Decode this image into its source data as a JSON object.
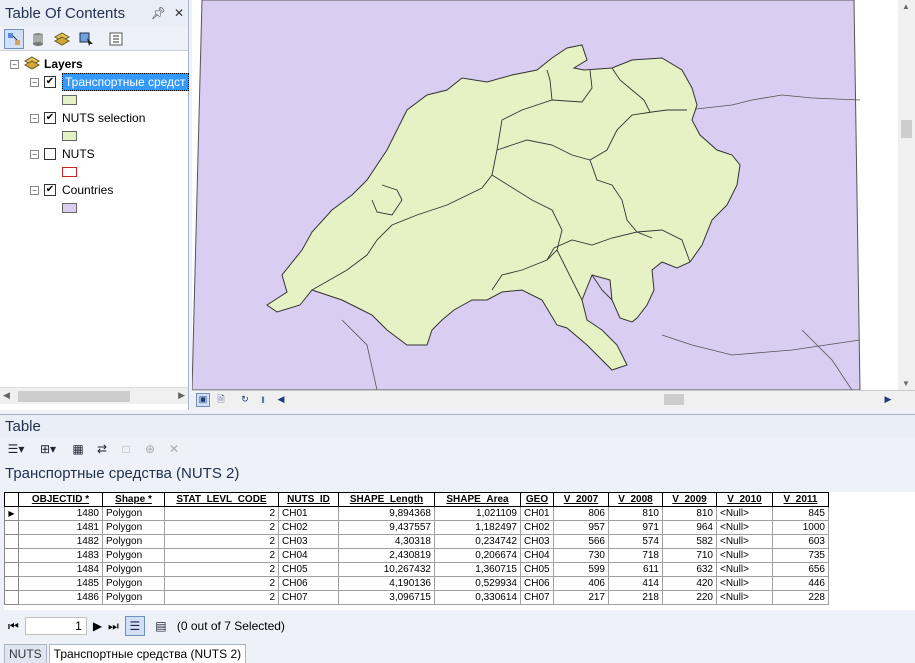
{
  "toc": {
    "title": "Table Of Contents",
    "pin_icon": "pin-icon",
    "close_icon": "close-icon",
    "root_label": "Layers",
    "layers": [
      {
        "label": "Транспортные средст",
        "checked": true,
        "selected": true,
        "fill": "#e6f2c4",
        "stroke": "#444444"
      },
      {
        "label": "NUTS selection",
        "checked": true,
        "selected": false,
        "fill": "#e6f2c4",
        "stroke": "#444444"
      },
      {
        "label": "NUTS",
        "checked": false,
        "selected": false,
        "fill": "#ffffff",
        "stroke": "#cc2222"
      },
      {
        "label": "Countries",
        "checked": true,
        "selected": false,
        "fill": "#d9cdf2",
        "stroke": "#444444"
      }
    ]
  },
  "map": {
    "background": "#d9cdf2",
    "region_fill": "#e6f2c4",
    "border_color": "#333333"
  },
  "table": {
    "window_title": "Table",
    "layer_title": "Транспортные средства (NUTS 2)",
    "columns": [
      "OBJECTID *",
      "Shape *",
      "STAT_LEVL_CODE",
      "NUTS_ID",
      "SHAPE_Length",
      "SHAPE_Area",
      "GEO",
      "V_2007",
      "V_2008",
      "V_2009",
      "V_2010",
      "V_2011"
    ],
    "rows": [
      [
        "1480",
        "Polygon",
        "2",
        "CH01",
        "9,894368",
        "1,021109",
        "CH01",
        "806",
        "810",
        "810",
        "<Null>",
        "845"
      ],
      [
        "1481",
        "Polygon",
        "2",
        "CH02",
        "9,437557",
        "1,182497",
        "CH02",
        "957",
        "971",
        "964",
        "<Null>",
        "1000"
      ],
      [
        "1482",
        "Polygon",
        "2",
        "CH03",
        "4,30318",
        "0,234742",
        "CH03",
        "566",
        "574",
        "582",
        "<Null>",
        "603"
      ],
      [
        "1483",
        "Polygon",
        "2",
        "CH04",
        "2,430819",
        "0,206674",
        "CH04",
        "730",
        "718",
        "710",
        "<Null>",
        "735"
      ],
      [
        "1484",
        "Polygon",
        "2",
        "CH05",
        "10,267432",
        "1,360715",
        "CH05",
        "599",
        "611",
        "632",
        "<Null>",
        "656"
      ],
      [
        "1485",
        "Polygon",
        "2",
        "CH06",
        "4,190136",
        "0,529934",
        "CH06",
        "406",
        "414",
        "420",
        "<Null>",
        "446"
      ],
      [
        "1486",
        "Polygon",
        "2",
        "CH07",
        "3,096715",
        "0,330614",
        "CH07",
        "217",
        "218",
        "220",
        "<Null>",
        "228"
      ]
    ],
    "record_number": "1",
    "selection_status": "(0 out of 7 Selected)",
    "tabs": [
      "NUTS",
      "Транспортные средства (NUTS 2)"
    ]
  }
}
